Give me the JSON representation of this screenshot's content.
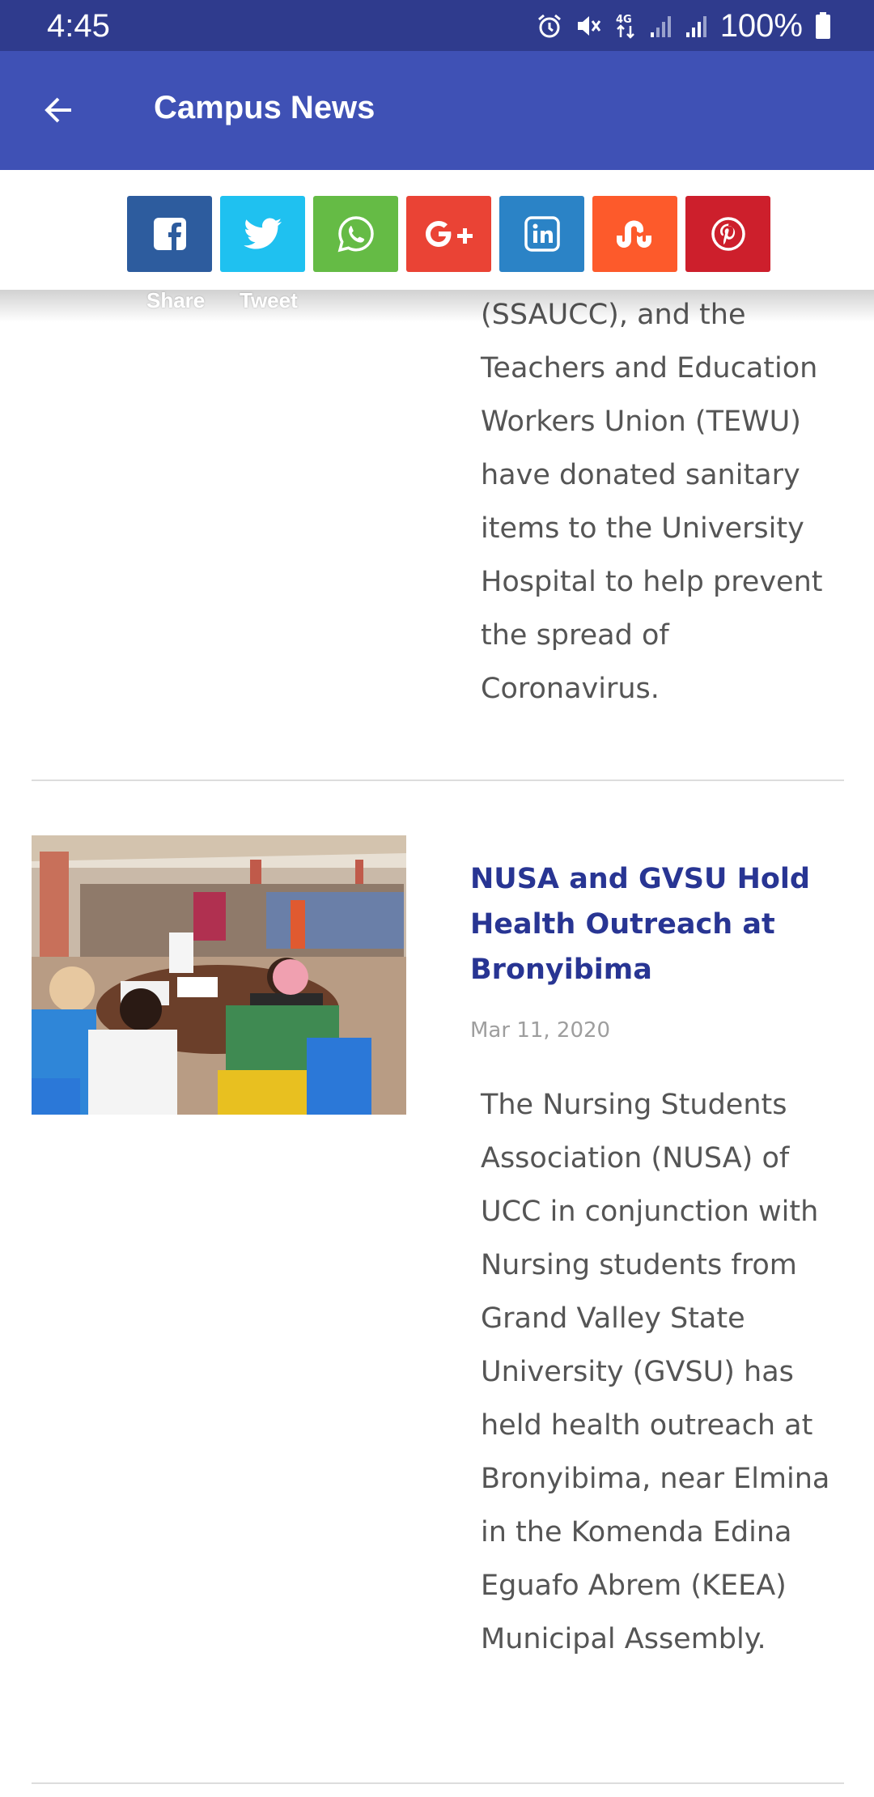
{
  "status_bar": {
    "time": "4:45",
    "battery": "100%",
    "icons": [
      "alarm-icon",
      "mute-icon",
      "4g-data-icon",
      "signal-icon",
      "signal-icon",
      "battery-icon"
    ]
  },
  "app_bar": {
    "title": "Campus News",
    "back_icon": "arrow-back-icon",
    "color": "#3f51b5"
  },
  "share_bar": {
    "buttons": [
      {
        "name": "facebook",
        "icon": "facebook-icon",
        "color": "#2d5c9e"
      },
      {
        "name": "twitter",
        "icon": "twitter-icon",
        "color": "#1fc1f0"
      },
      {
        "name": "whatsapp",
        "icon": "whatsapp-icon",
        "color": "#65bb45"
      },
      {
        "name": "google-plus",
        "icon": "google-plus-icon",
        "color": "#ea4335"
      },
      {
        "name": "linkedin",
        "icon": "linkedin-icon",
        "color": "#2b83c6"
      },
      {
        "name": "stumbleupon",
        "icon": "stumbleupon-icon",
        "color": "#fd5a2b"
      },
      {
        "name": "pinterest",
        "icon": "pinterest-icon",
        "color": "#cd1f2c"
      }
    ],
    "share_label": "Share",
    "tweet_label": "Tweet"
  },
  "articles": [
    {
      "excerpt": "(SSAUCC), and the Teachers and Education Workers Union (TEWU) have donated sanitary items to the University Hospital to help prevent the spread of Coronavirus."
    },
    {
      "title": "NUSA and GVSU Hold Health Outreach at Bronyibima",
      "date": "Mar 11, 2020",
      "excerpt": "The Nursing Students Association (NUSA) of UCC in conjunction with Nursing students from Grand Valley State University (GVSU) has held health outreach at Bronyibima, near Elmina in the Komenda Edina Eguafo Abrem (KEEA) Municipal Assembly."
    }
  ],
  "colors": {
    "status_bar": "#2f3b8d",
    "title_text": "#283593",
    "body_text": "#555555",
    "date_text": "#9e9e9e"
  }
}
